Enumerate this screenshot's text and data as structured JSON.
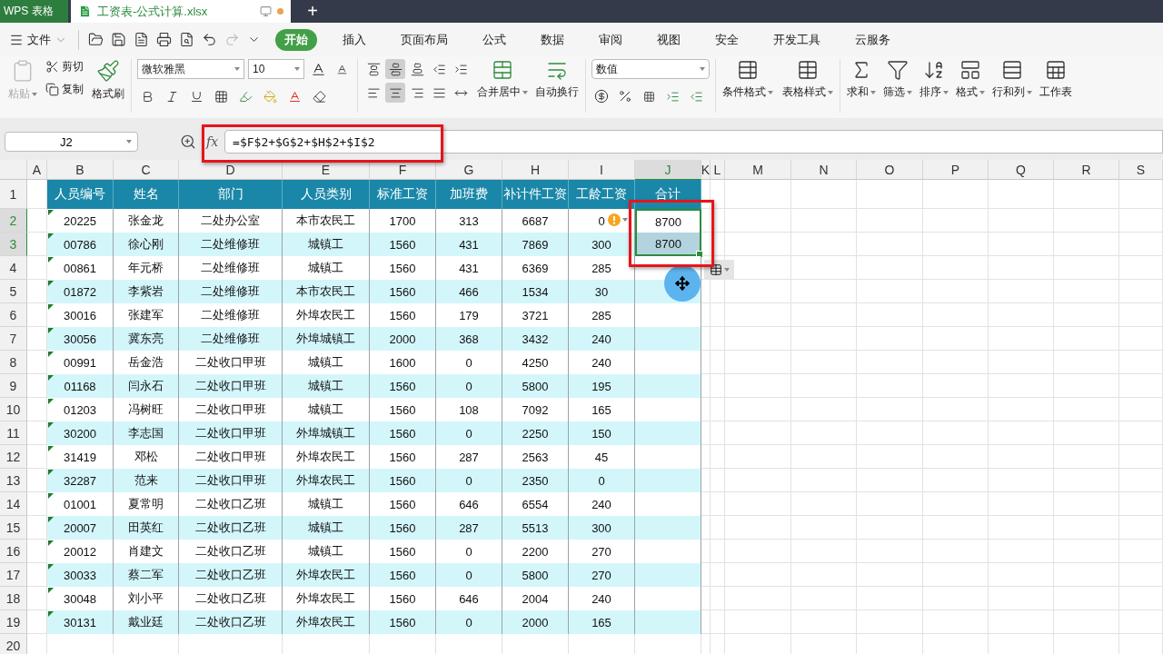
{
  "tab_bar": {
    "app_tab": "WPS 表格",
    "doc_tab": {
      "title": "工资表-公式计算.xlsx",
      "modified": true
    },
    "new_tab": "+"
  },
  "menu": {
    "file": "文件",
    "tabs": [
      {
        "label": "开始",
        "selected": true
      },
      {
        "label": "插入",
        "selected": false
      },
      {
        "label": "页面布局",
        "selected": false
      },
      {
        "label": "公式",
        "selected": false
      },
      {
        "label": "数据",
        "selected": false
      },
      {
        "label": "审阅",
        "selected": false
      },
      {
        "label": "视图",
        "selected": false
      },
      {
        "label": "安全",
        "selected": false
      },
      {
        "label": "开发工具",
        "selected": false
      },
      {
        "label": "云服务",
        "selected": false
      }
    ]
  },
  "ribbon": {
    "paste": {
      "label": "粘贴",
      "disabled": true
    },
    "cut": "剪切",
    "copy": "复制",
    "format_painter": "格式刷",
    "font_name": "微软雅黑",
    "font_size": "10",
    "number_format": "数值",
    "align_buttons": [
      {
        "kind": "top",
        "selected": false
      },
      {
        "kind": "middle",
        "selected": true
      },
      {
        "kind": "bottom",
        "selected": false
      },
      {
        "kind": "outdent",
        "selected": false
      },
      {
        "kind": "indent",
        "selected": false
      },
      {
        "kind": "left",
        "selected": false
      },
      {
        "kind": "center",
        "selected": true
      },
      {
        "kind": "right",
        "selected": false
      },
      {
        "kind": "justify",
        "selected": false
      },
      {
        "kind": "distribute",
        "selected": false
      }
    ],
    "buttons": [
      {
        "kind": "merge",
        "label": "合并居中",
        "dropdown": true
      },
      {
        "kind": "wrap",
        "label": "自动换行",
        "dropdown": false
      },
      {
        "kind": "conditional",
        "label": "条件格式",
        "dropdown": true
      },
      {
        "kind": "table_style",
        "label": "表格样式",
        "dropdown": true
      },
      {
        "kind": "sum",
        "label": "求和",
        "dropdown": true
      },
      {
        "kind": "filter",
        "label": "筛选",
        "dropdown": true
      },
      {
        "kind": "sort",
        "label": "排序",
        "dropdown": true
      },
      {
        "kind": "format",
        "label": "格式",
        "dropdown": true
      },
      {
        "kind": "rows_cols",
        "label": "行和列",
        "dropdown": true
      },
      {
        "kind": "sheet",
        "label": "工作表",
        "dropdown": false
      }
    ]
  },
  "formula_bar": {
    "name_box": "J2",
    "function_label": "fx",
    "formula": "=$F$2+$G$2+$H$2+$I$2"
  },
  "sheet": {
    "columns": [
      {
        "label": "A",
        "selected": false
      },
      {
        "label": "B",
        "selected": false
      },
      {
        "label": "C",
        "selected": false
      },
      {
        "label": "D",
        "selected": false
      },
      {
        "label": "E",
        "selected": false
      },
      {
        "label": "F",
        "selected": false
      },
      {
        "label": "G",
        "selected": false
      },
      {
        "label": "H",
        "selected": false
      },
      {
        "label": "I",
        "selected": false
      },
      {
        "label": "J",
        "selected": true
      },
      {
        "label": "K",
        "selected": false
      },
      {
        "label": "L",
        "selected": false
      },
      {
        "label": "M",
        "selected": false
      },
      {
        "label": "N",
        "selected": false
      },
      {
        "label": "O",
        "selected": false
      },
      {
        "label": "P",
        "selected": false
      },
      {
        "label": "Q",
        "selected": false
      },
      {
        "label": "R",
        "selected": false
      },
      {
        "label": "S",
        "selected": false
      }
    ],
    "header": {
      "number": "1",
      "cells": [
        "人员编号",
        "姓名",
        "部门",
        "人员类别",
        "标准工资",
        "加班费",
        "补计件工资",
        "工龄工资",
        "合计"
      ]
    },
    "rows": [
      {
        "number": "2",
        "selected": true,
        "active": true,
        "warning": true,
        "flag": true,
        "cells": [
          "20225",
          "张金龙",
          "二处办公室",
          "本市农民工",
          "1700",
          "313",
          "6687",
          "0",
          "8700"
        ]
      },
      {
        "number": "3",
        "selected": true,
        "active": false,
        "warning": false,
        "flag": true,
        "cells": [
          "00786",
          "徐心刚",
          "二处维修班",
          "城镇工",
          "1560",
          "431",
          "7869",
          "300",
          "8700"
        ]
      },
      {
        "number": "4",
        "selected": false,
        "active": false,
        "warning": false,
        "flag": true,
        "cells": [
          "00861",
          "年元桥",
          "二处维修班",
          "城镇工",
          "1560",
          "431",
          "6369",
          "285"
        ]
      },
      {
        "number": "5",
        "selected": false,
        "active": false,
        "warning": false,
        "flag": true,
        "cells": [
          "01872",
          "李紫岩",
          "二处维修班",
          "本市农民工",
          "1560",
          "466",
          "1534",
          "30"
        ]
      },
      {
        "number": "6",
        "selected": false,
        "active": false,
        "warning": false,
        "flag": true,
        "cells": [
          "30016",
          "张建军",
          "二处维修班",
          "外埠农民工",
          "1560",
          "179",
          "3721",
          "285"
        ]
      },
      {
        "number": "7",
        "selected": false,
        "active": false,
        "warning": false,
        "flag": true,
        "cells": [
          "30056",
          "冀东亮",
          "二处维修班",
          "外埠城镇工",
          "2000",
          "368",
          "3432",
          "240"
        ]
      },
      {
        "number": "8",
        "selected": false,
        "active": false,
        "warning": false,
        "flag": true,
        "cells": [
          "00991",
          "岳金浩",
          "二处收口甲班",
          "城镇工",
          "1600",
          "0",
          "4250",
          "240"
        ]
      },
      {
        "number": "9",
        "selected": false,
        "active": false,
        "warning": false,
        "flag": true,
        "cells": [
          "01168",
          "闫永石",
          "二处收口甲班",
          "城镇工",
          "1560",
          "0",
          "5800",
          "195"
        ]
      },
      {
        "number": "10",
        "selected": false,
        "active": false,
        "warning": false,
        "flag": true,
        "cells": [
          "01203",
          "冯树旺",
          "二处收口甲班",
          "城镇工",
          "1560",
          "108",
          "7092",
          "165"
        ]
      },
      {
        "number": "11",
        "selected": false,
        "active": false,
        "warning": false,
        "flag": true,
        "cells": [
          "30200",
          "李志国",
          "二处收口甲班",
          "外埠城镇工",
          "1560",
          "0",
          "2250",
          "150"
        ]
      },
      {
        "number": "12",
        "selected": false,
        "active": false,
        "warning": false,
        "flag": true,
        "cells": [
          "31419",
          "邓松",
          "二处收口甲班",
          "外埠农民工",
          "1560",
          "287",
          "2563",
          "45"
        ]
      },
      {
        "number": "13",
        "selected": false,
        "active": false,
        "warning": false,
        "flag": true,
        "cells": [
          "32287",
          "范来",
          "二处收口甲班",
          "外埠农民工",
          "1560",
          "0",
          "2350",
          "0"
        ]
      },
      {
        "number": "14",
        "selected": false,
        "active": false,
        "warning": false,
        "flag": true,
        "cells": [
          "01001",
          "夏常明",
          "二处收口乙班",
          "城镇工",
          "1560",
          "646",
          "6554",
          "240"
        ]
      },
      {
        "number": "15",
        "selected": false,
        "active": false,
        "warning": false,
        "flag": true,
        "cells": [
          "20007",
          "田英红",
          "二处收口乙班",
          "城镇工",
          "1560",
          "287",
          "5513",
          "300"
        ]
      },
      {
        "number": "16",
        "selected": false,
        "active": false,
        "warning": false,
        "flag": true,
        "cells": [
          "20012",
          "肖建文",
          "二处收口乙班",
          "城镇工",
          "1560",
          "0",
          "2200",
          "270"
        ]
      },
      {
        "number": "17",
        "selected": false,
        "active": false,
        "warning": false,
        "flag": true,
        "cells": [
          "30033",
          "蔡二军",
          "二处收口乙班",
          "外埠农民工",
          "1560",
          "0",
          "5800",
          "270"
        ]
      },
      {
        "number": "18",
        "selected": false,
        "active": false,
        "warning": false,
        "flag": true,
        "cells": [
          "30048",
          "刘小平",
          "二处收口乙班",
          "外埠农民工",
          "1560",
          "646",
          "2004",
          "240"
        ]
      },
      {
        "number": "19",
        "selected": false,
        "active": false,
        "warning": false,
        "flag": true,
        "cells": [
          "30131",
          "戴业廷",
          "二处收口乙班",
          "外埠农民工",
          "1560",
          "0",
          "2000",
          "165"
        ]
      },
      {
        "number": "20",
        "selected": false,
        "active": false,
        "warning": false,
        "flag": false
      }
    ]
  }
}
